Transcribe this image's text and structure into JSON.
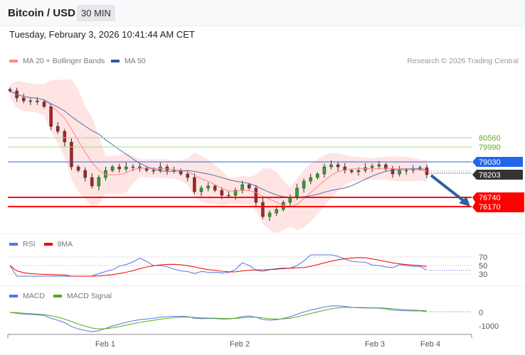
{
  "header": {
    "title": "Bitcoin / USD",
    "timeframe": "30 MIN"
  },
  "datetime": "Tuesday, February 3, 2026 10:41:44 AM CET",
  "legend": {
    "ma20": "MA 20 + Bollinger Bands",
    "ma50": "MA 50",
    "rsi": "RSI",
    "rsi_ma": "9MA",
    "macd": "MACD",
    "macd_signal": "MACD Signal"
  },
  "credit": "Research © 2026 Trading Central",
  "colors": {
    "resistance": "#66aa22",
    "pivot": "#2266ee",
    "support": "#ff0000",
    "last": "#333333",
    "ma20": "#ff8888",
    "ma50": "#335599",
    "arrow": "#2f5f9f"
  },
  "levels": {
    "r2": "80560",
    "r1": "79990",
    "pivot": "79030",
    "last": "78203",
    "s1": "76740",
    "s2": "76170"
  },
  "rsi_axis": [
    "70",
    "50",
    "30"
  ],
  "macd_axis": [
    "0",
    "-1000"
  ],
  "x_labels": [
    "Feb 1",
    "Feb 2",
    "Feb 3",
    "Feb 4"
  ],
  "chart_data": {
    "type": "candlestick",
    "closes": [
      83547,
      83095,
      82913,
      82913,
      82850,
      82551,
      81284,
      80967,
      80288,
      78704,
      78478,
      78025,
      77483,
      78025,
      78478,
      78704,
      78569,
      78704,
      78704,
      78600,
      78478,
      78478,
      78704,
      78478,
      78478,
      78252,
      78025,
      77121,
      77347,
      77483,
      77211,
      76894,
      76894,
      77211,
      77573,
      77347,
      76441,
      75536,
      75762,
      75989,
      76441,
      76758,
      77347,
      77799,
      78025,
      78252,
      78704,
      78840,
      78704,
      78478,
      78388,
      78478,
      78659,
      78750,
      78840,
      78569,
      78252,
      78478,
      78478,
      78569,
      78659,
      78203
    ]
  }
}
